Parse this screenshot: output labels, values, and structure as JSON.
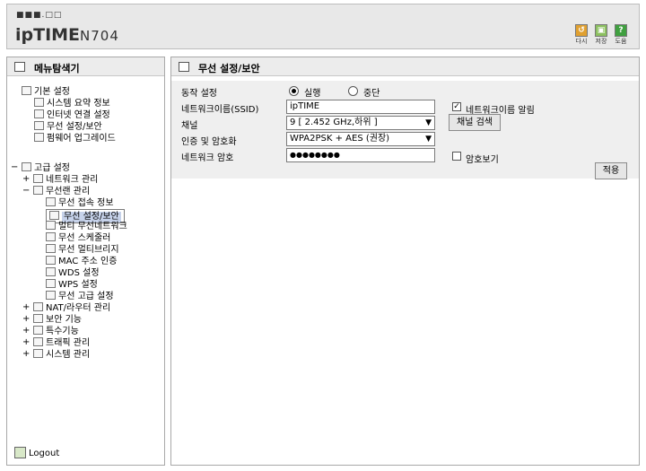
{
  "header": {
    "logo_text": "ipTIME",
    "model": "N704",
    "buttons": [
      {
        "label": "다시",
        "icon": "refresh-icon",
        "color": "#e0a030"
      },
      {
        "label": "저장",
        "icon": "save-icon",
        "color": "#8cc060"
      },
      {
        "label": "도움",
        "icon": "help-icon",
        "color": "#40a040",
        "glyph": "?"
      }
    ]
  },
  "sidebar": {
    "title": "메뉴탐색기",
    "basic": {
      "label": "기본 설정",
      "items": [
        "시스템 요약 정보",
        "인터넷 연결 설정",
        "무선 설정/보안",
        "펌웨어 업그레이드"
      ]
    },
    "advanced": {
      "label": "고급 설정",
      "network": "네트워크 관리",
      "wireless": "무선랜 관리",
      "wireless_items": [
        "무선 접속 정보",
        "무선 설정/보안",
        "멀티 무선네트워크",
        "무선 스케줄러",
        "무선 멀티브리지",
        "MAC 주소 인증",
        "WDS 설정",
        "WPS 설정",
        "무선 고급 설정"
      ],
      "selected": "무선 설정/보안",
      "others": [
        "NAT/라우터 관리",
        "보안 기능",
        "특수기능",
        "트래픽 관리",
        "시스템 관리"
      ]
    },
    "logout": "Logout",
    "accent": "#c6d2ea"
  },
  "main": {
    "title": "무선 설정/보안",
    "fields": {
      "operation": {
        "label": "동작 설정",
        "opt_run": "실행",
        "opt_stop": "중단",
        "selected": "실행"
      },
      "ssid": {
        "label": "네트워크이름(SSID)",
        "value": "ipTIME",
        "broadcast_label": "네트워크이름 알림",
        "broadcast_checked": true
      },
      "channel": {
        "label": "채널",
        "value": "9 [ 2.452 GHz,하위 ]",
        "search_button": "채널 검색"
      },
      "auth": {
        "label": "인증 및 암호화",
        "value": "WPA2PSK + AES (권장)"
      },
      "password": {
        "label": "네트워크 암호",
        "value": "●●●●●●●●",
        "show_label": "암호보기",
        "show_checked": false
      }
    },
    "apply_button": "적용"
  }
}
